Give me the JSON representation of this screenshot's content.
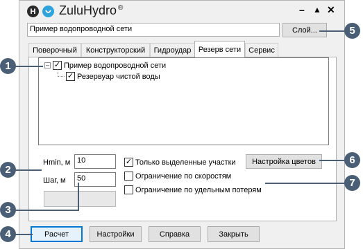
{
  "app": {
    "logo_letter": "H",
    "title": "ZuluHydro",
    "registered_mark": "®",
    "controls": {
      "minimize": "–",
      "maximize": "▲",
      "close": "✕"
    }
  },
  "layer": {
    "value": "Пример водопроводной сети",
    "button_label": "Слой..."
  },
  "tabs": [
    "Поверочный",
    "Конструкторский",
    "Гидроудар",
    "Резерв сети",
    "Сервис"
  ],
  "tree": {
    "root_label": "Пример водопроводной сети",
    "child_label": "Резервуар чистой воды"
  },
  "params": {
    "hmin_label": "Hmin, м",
    "hmin_value": "10",
    "step_label": "Шаг, м",
    "step_value": "50"
  },
  "options": {
    "selected_only": "Только выделенные участки",
    "speed_limit": "Ограничение по скоростям",
    "loss_limit": "Ограничение по удельным потерям",
    "colors_button": "Настройка цветов"
  },
  "buttons": {
    "calculate": "Расчет",
    "settings": "Настройки",
    "help": "Справка",
    "close": "Закрыть"
  },
  "callouts": [
    "1",
    "2",
    "3",
    "4",
    "5",
    "6",
    "7"
  ],
  "colors": {
    "callout": "#4a5f75",
    "accent": "#0078d7"
  }
}
